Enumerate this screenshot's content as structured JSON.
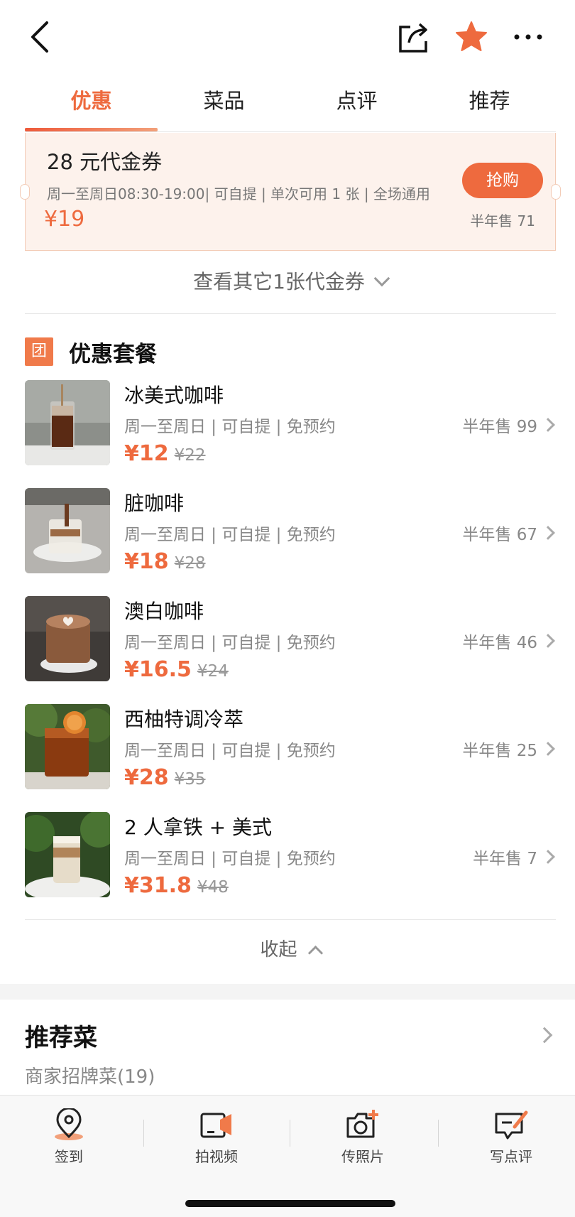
{
  "header": {
    "back_icon": "chevron-left-icon",
    "share_icon": "share-icon",
    "favorite_icon": "star-icon",
    "favorite_color": "#ee6a3e",
    "more_icon": "more-dots-icon"
  },
  "tabs": [
    {
      "label": "优惠",
      "active": true
    },
    {
      "label": "菜品",
      "active": false
    },
    {
      "label": "点评",
      "active": false
    },
    {
      "label": "推荐",
      "active": false
    }
  ],
  "coupon": {
    "title": "28 元代金券",
    "desc": "周一至周日08:30-19:00| 可自提 | 单次可用 1 张 | 全场通用",
    "price": "¥19",
    "button_label": "抢购",
    "sales": "半年售 71"
  },
  "more_coupons_label": "查看其它1张代金券",
  "deals": {
    "icon_text": "团",
    "title": "优惠套餐",
    "items": [
      {
        "name": "冰美式咖啡",
        "desc": "周一至周日 | 可自提 | 免预约",
        "price": "¥12",
        "orig_price": "¥22",
        "sales": "半年售 99"
      },
      {
        "name": "脏咖啡",
        "desc": "周一至周日 | 可自提 | 免预约",
        "price": "¥18",
        "orig_price": "¥28",
        "sales": "半年售 67"
      },
      {
        "name": "澳白咖啡",
        "desc": "周一至周日 | 可自提 | 免预约",
        "price": "¥16.5",
        "orig_price": "¥24",
        "sales": "半年售 46"
      },
      {
        "name": "西柚特调冷萃",
        "desc": "周一至周日 | 可自提 | 免预约",
        "price": "¥28",
        "orig_price": "¥35",
        "sales": "半年售 25"
      },
      {
        "name": "2 人拿铁 + 美式",
        "desc": "周一至周日 | 可自提 | 免预约",
        "price": "¥31.8",
        "orig_price": "¥48",
        "sales": "半年售 7"
      }
    ],
    "collapse_label": "收起"
  },
  "recommend": {
    "title": "推荐菜",
    "subtitle": "商家招牌菜(19)"
  },
  "bottom_bar": [
    {
      "label": "签到",
      "icon": "location-pin-icon"
    },
    {
      "label": "拍视频",
      "icon": "video-camera-icon"
    },
    {
      "label": "传照片",
      "icon": "camera-add-icon"
    },
    {
      "label": "写点评",
      "icon": "write-review-icon"
    }
  ],
  "colors": {
    "accent": "#ee6a3e",
    "coupon_bg": "#fdf2ec"
  }
}
